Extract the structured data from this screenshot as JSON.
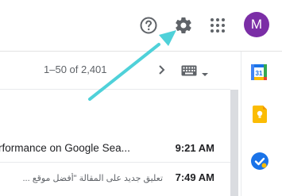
{
  "header": {
    "help_icon": "help-circle-icon",
    "settings_icon": "gear-icon",
    "apps_icon": "apps-grid-icon",
    "avatar_initial": "M",
    "avatar_color": "#7b2ea6"
  },
  "toolbar": {
    "pager": "1–50 of 2,401",
    "next_icon": "chevron-right-icon",
    "input_tools_icon": "keyboard-icon",
    "input_tools_menu_icon": "caret-down-icon"
  },
  "emails": [
    {
      "subject": "rformance on Google Sea...",
      "time": "9:21 AM"
    },
    {
      "subject": "تعليق جديد على المقالة \"أفضل موقع ...",
      "time": "7:49 AM"
    }
  ],
  "side_panel": {
    "apps": [
      {
        "name": "calendar-icon",
        "text": "31",
        "color": "#1a73e8"
      },
      {
        "name": "keep-icon",
        "color": "#fbbc04"
      },
      {
        "name": "tasks-icon",
        "color": "#1a73e8"
      }
    ]
  },
  "annotation": {
    "arrow_color": "#4fd1d9"
  }
}
